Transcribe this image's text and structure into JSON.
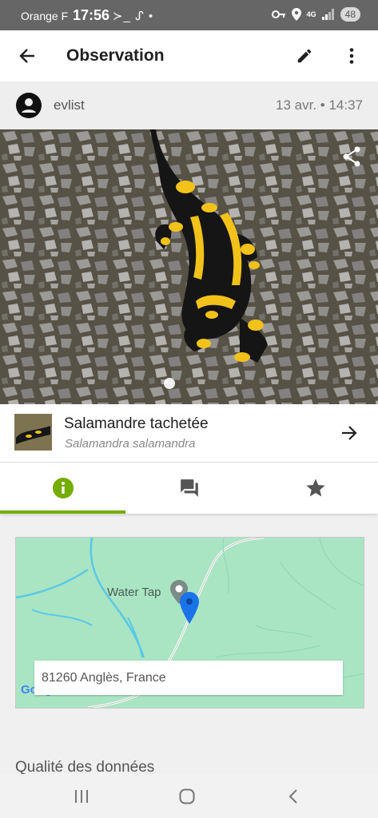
{
  "status_bar": {
    "carrier": "Orange F",
    "time": "17:56",
    "extra_icons": "≻_ ᔑ •",
    "network": "4G",
    "battery": "48"
  },
  "app_bar": {
    "title": "Observation",
    "back_icon": "arrow-left-icon",
    "edit_icon": "pencil-icon",
    "menu_icon": "more-vert-icon"
  },
  "observer": {
    "username": "evlist",
    "datetime": "13 avr. • 14:37"
  },
  "photo": {
    "description_icon": "share-icon",
    "page_indicator_count": 1
  },
  "taxon": {
    "common_name": "Salamandre tachetée",
    "scientific_name": "Salamandra salamandra"
  },
  "tabs": [
    {
      "name": "info",
      "icon": "info-icon",
      "active": true
    },
    {
      "name": "comments",
      "icon": "forum-icon",
      "active": false
    },
    {
      "name": "favorites",
      "icon": "star-icon",
      "active": false
    }
  ],
  "map": {
    "place_label": "Water Tap",
    "address": "81260 Anglès, France",
    "logo": "Google"
  },
  "section": {
    "quality_title": "Qualité des données"
  },
  "colors": {
    "accent_green": "#74ac00",
    "map_bg": "#a9e5c3",
    "pin_blue": "#1a73e8"
  }
}
